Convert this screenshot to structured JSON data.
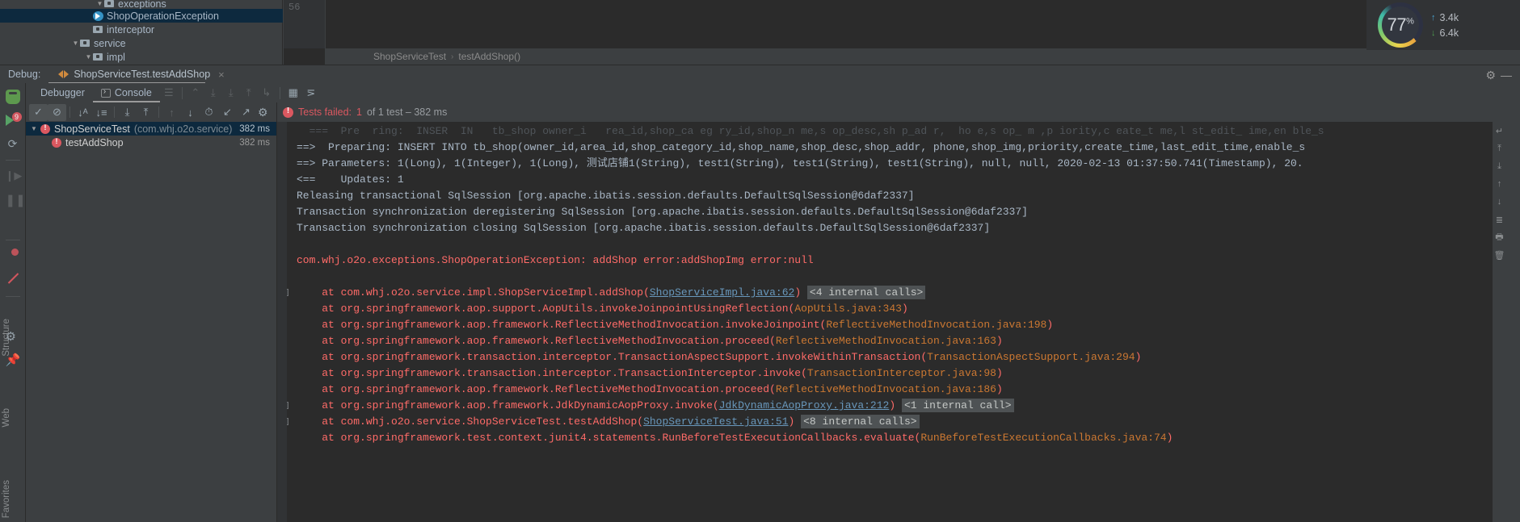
{
  "project_tree": {
    "rows": [
      {
        "label": "exceptions",
        "icon": "folder-icon",
        "indent": 118,
        "arrow": "▼",
        "selected": false,
        "type": "folder"
      },
      {
        "label": "ShopOperationException",
        "icon": "class-icon",
        "indent": 104,
        "arrow": "",
        "selected": true,
        "type": "class"
      },
      {
        "label": "interceptor",
        "icon": "folder-icon",
        "indent": 104,
        "arrow": "",
        "selected": false,
        "type": "folder"
      },
      {
        "label": "service",
        "icon": "folder-icon",
        "indent": 88,
        "arrow": "▼",
        "selected": false,
        "type": "folder"
      },
      {
        "label": "impl",
        "icon": "folder-icon",
        "indent": 104,
        "arrow": "▼",
        "selected": false,
        "type": "folder"
      }
    ]
  },
  "editor": {
    "line_number": "56",
    "breadcrumb": {
      "class": "ShopServiceTest",
      "separator": "›",
      "method": "testAddShop()"
    }
  },
  "network_widget": {
    "percent": "77",
    "percent_symbol": "%",
    "upload": "3.4k",
    "download": "6.4k",
    "up_arrow": "↑",
    "down_arrow": "↓"
  },
  "debug_tabbar": {
    "label": "Debug:",
    "tab_title": "ShopServiceTest.testAddShop",
    "close": "×",
    "gear": "⚙",
    "minimize": "—"
  },
  "icon_rail": {
    "items": [
      {
        "name": "debug-bug-icon"
      },
      {
        "name": "resume-program-icon",
        "badge": "9"
      },
      {
        "name": "rerun-icon"
      },
      {
        "name": "step-over-icon"
      },
      {
        "name": "pause-icon"
      },
      {
        "name": "stop-icon"
      },
      {
        "name": "view-breakpoints-icon"
      },
      {
        "name": "mute-breakpoints-icon"
      },
      {
        "name": "camera-icon"
      },
      {
        "name": "settings-icon"
      },
      {
        "name": "pin-icon"
      }
    ],
    "vertical_labels": {
      "structure": "Structure",
      "web": "Web",
      "favorites": "Favorites"
    }
  },
  "debugger_toolbar": {
    "tabs": [
      {
        "label": "Debugger",
        "active": false
      },
      {
        "label": "Console",
        "active": true
      }
    ],
    "icons": [
      "menu-icon",
      "soft-wrap-icon",
      "scroll-to-end-icon",
      "scroll-down-icon",
      "scroll-up-icon",
      "print-icon",
      "table-icon",
      "filter-icon"
    ]
  },
  "test_toolbar": {
    "buttons": [
      {
        "name": "show-passed-button",
        "glyph": "✓",
        "pressed": true
      },
      {
        "name": "show-ignored-button",
        "glyph": "⊘",
        "pressed": true
      },
      {
        "name": "sort-alphabetically-button",
        "glyph": "↓ᵃz"
      },
      {
        "name": "sort-by-duration-button",
        "glyph": "↓≡"
      },
      {
        "name": "expand-all-button",
        "glyph": "⤓"
      },
      {
        "name": "collapse-all-button",
        "glyph": "⤒"
      },
      {
        "name": "prev-failed-button",
        "glyph": "↑",
        "dim": true
      },
      {
        "name": "next-failed-button",
        "glyph": "↓"
      },
      {
        "name": "test-history-button",
        "glyph": "🕐"
      },
      {
        "name": "import-tests-button",
        "glyph": "↙"
      },
      {
        "name": "export-tests-button",
        "glyph": "↗"
      }
    ]
  },
  "test_status": {
    "prefix": "Tests failed:",
    "count": "1",
    "suffix": "of 1 test – 382 ms"
  },
  "test_tree": {
    "rows": [
      {
        "arrow": "▼",
        "name": "ShopServiceTest",
        "package": "(com.whj.o2o.service)",
        "time": "382 ms",
        "selected": true,
        "indent": 0
      },
      {
        "arrow": "",
        "name": "testAddShop",
        "package": "",
        "time": "382 ms",
        "selected": false,
        "indent": 20
      }
    ]
  },
  "console": {
    "lines": [
      {
        "type": "faded",
        "segments": [
          {
            "t": "  ===  Pre  ring:  INSER  IN   tb_shop owner_i   rea_id,shop_ca eg ry_id,shop_n me,s op_desc,sh p_ad r,  ho e,s op_ m ,p iority,c eate_t me,l st_edit_ ime,en ble_s"
          }
        ]
      },
      {
        "type": "normal",
        "segments": [
          {
            "t": "==>  Preparing: INSERT INTO tb_shop(owner_id,area_id,shop_category_id,shop_name,shop_desc,shop_addr, phone,shop_img,priority,create_time,last_edit_time,enable_s"
          }
        ]
      },
      {
        "type": "normal",
        "segments": [
          {
            "t": "==> Parameters: 1(Long), 1(Integer), 1(Long), 测试店铺1(String), test1(String), test1(String), test1(String), null, null, 2020-02-13 01:37:50.741(Timestamp), 20."
          }
        ]
      },
      {
        "type": "normal",
        "segments": [
          {
            "t": "<==    Updates: 1"
          }
        ]
      },
      {
        "type": "normal",
        "segments": [
          {
            "t": "Releasing transactional SqlSession [org.apache.ibatis.session.defaults.DefaultSqlSession@6daf2337]"
          }
        ]
      },
      {
        "type": "normal",
        "segments": [
          {
            "t": "Transaction synchronization deregistering SqlSession [org.apache.ibatis.session.defaults.DefaultSqlSession@6daf2337]"
          }
        ]
      },
      {
        "type": "normal",
        "segments": [
          {
            "t": "Transaction synchronization closing SqlSession [org.apache.ibatis.session.defaults.DefaultSqlSession@6daf2337]"
          }
        ]
      },
      {
        "type": "blank",
        "segments": [
          {
            "t": ""
          }
        ]
      },
      {
        "type": "red",
        "segments": [
          {
            "t": "com.whj.o2o.exceptions.ShopOperationException: addShop error:addShopImg error:null"
          }
        ]
      },
      {
        "type": "blank",
        "segments": [
          {
            "t": ""
          }
        ]
      },
      {
        "type": "red",
        "fold": "+",
        "segments": [
          {
            "t": "    at com.whj.o2o.service.impl.ShopServiceImpl.addShop("
          },
          {
            "t": "ShopServiceImpl.java:62",
            "link": true
          },
          {
            "t": ") "
          },
          {
            "t": "<4 internal calls>",
            "internal": true
          }
        ]
      },
      {
        "type": "red",
        "segments": [
          {
            "t": "    at org.springframework.aop.support.AopUtils.invokeJoinpointUsingReflection("
          },
          {
            "t": "AopUtils.java:343",
            "linkdim": true
          },
          {
            "t": ")"
          }
        ]
      },
      {
        "type": "red",
        "segments": [
          {
            "t": "    at org.springframework.aop.framework.ReflectiveMethodInvocation.invokeJoinpoint("
          },
          {
            "t": "ReflectiveMethodInvocation.java:198",
            "linkdim": true
          },
          {
            "t": ")"
          }
        ]
      },
      {
        "type": "red",
        "segments": [
          {
            "t": "    at org.springframework.aop.framework.ReflectiveMethodInvocation.proceed("
          },
          {
            "t": "ReflectiveMethodInvocation.java:163",
            "linkdim": true
          },
          {
            "t": ")"
          }
        ]
      },
      {
        "type": "red",
        "segments": [
          {
            "t": "    at org.springframework.transaction.interceptor.TransactionAspectSupport.invokeWithinTransaction("
          },
          {
            "t": "TransactionAspectSupport.java:294",
            "linkdim": true
          },
          {
            "t": ")"
          }
        ]
      },
      {
        "type": "red",
        "segments": [
          {
            "t": "    at org.springframework.transaction.interceptor.TransactionInterceptor.invoke("
          },
          {
            "t": "TransactionInterceptor.java:98",
            "linkdim": true
          },
          {
            "t": ")"
          }
        ]
      },
      {
        "type": "red",
        "segments": [
          {
            "t": "    at org.springframework.aop.framework.ReflectiveMethodInvocation.proceed("
          },
          {
            "t": "ReflectiveMethodInvocation.java:186",
            "linkdim": true
          },
          {
            "t": ")"
          }
        ]
      },
      {
        "type": "red",
        "fold": "+",
        "segments": [
          {
            "t": "    at org.springframework.aop.framework.JdkDynamicAopProxy.invoke("
          },
          {
            "t": "JdkDynamicAopProxy.java:212",
            "link": true
          },
          {
            "t": ") "
          },
          {
            "t": "<1 internal call>",
            "internal": true
          }
        ]
      },
      {
        "type": "red",
        "fold": "+",
        "segments": [
          {
            "t": "    at com.whj.o2o.service.ShopServiceTest.testAddShop("
          },
          {
            "t": "ShopServiceTest.java:51",
            "link": true
          },
          {
            "t": ") "
          },
          {
            "t": "<8 internal calls>",
            "internal": true
          }
        ]
      },
      {
        "type": "red",
        "segments": [
          {
            "t": "    at org.springframework.test.context.junit4.statements.RunBeforeTestExecutionCallbacks.evaluate("
          },
          {
            "t": "RunBeforeTestExecutionCallbacks.java:74",
            "linkdim": true
          },
          {
            "t": ")"
          }
        ]
      }
    ]
  },
  "right_rail": {
    "icons": [
      "wrap-text-icon",
      "scroll-end-icon",
      "scroll-down-icon",
      "up-icon",
      "down-icon",
      "list-icon",
      "print-icon",
      "trash-icon"
    ]
  }
}
